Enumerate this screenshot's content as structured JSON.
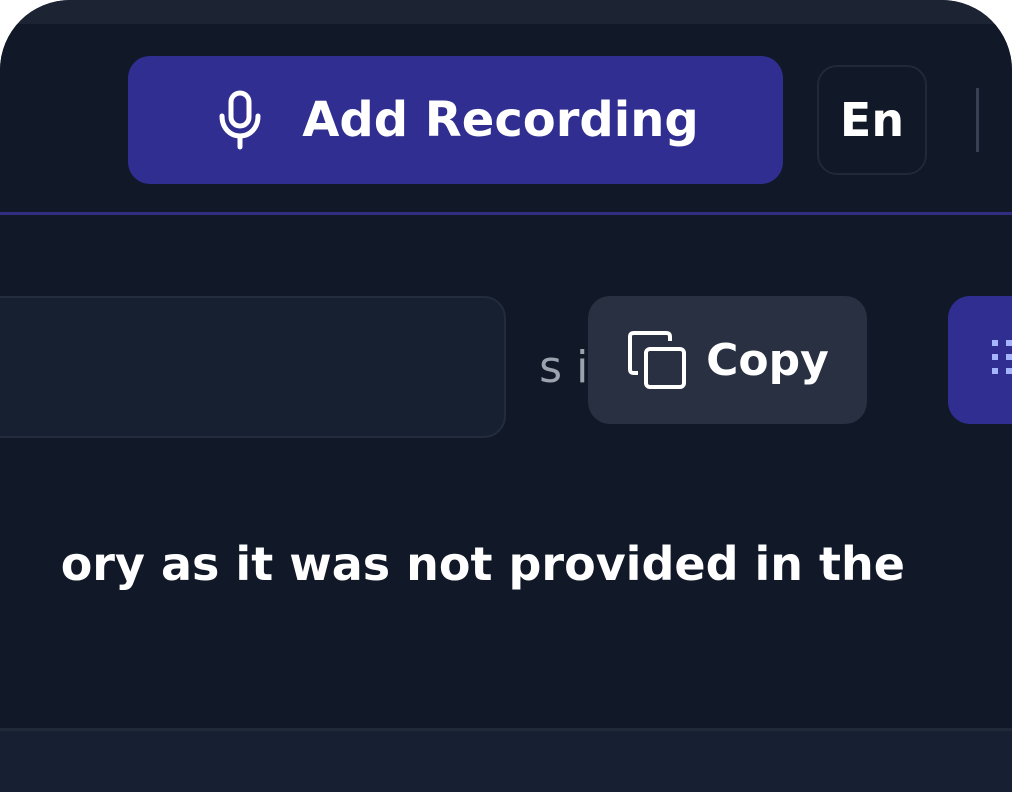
{
  "header": {
    "add_recording_label": "Add Recording",
    "add_recording_icon": "microphone-icon",
    "language_label": "En"
  },
  "toolbar": {
    "initials_value": "s initials",
    "copy_label": "Copy",
    "copy_icon": "copy-icon",
    "side_button_icon": "grip-icon"
  },
  "content": {
    "body_text": "ory as it was not provided in the"
  },
  "colors": {
    "background": "#111827",
    "accent": "#312e91",
    "button_secondary": "#283041",
    "divider": "#312e81"
  }
}
